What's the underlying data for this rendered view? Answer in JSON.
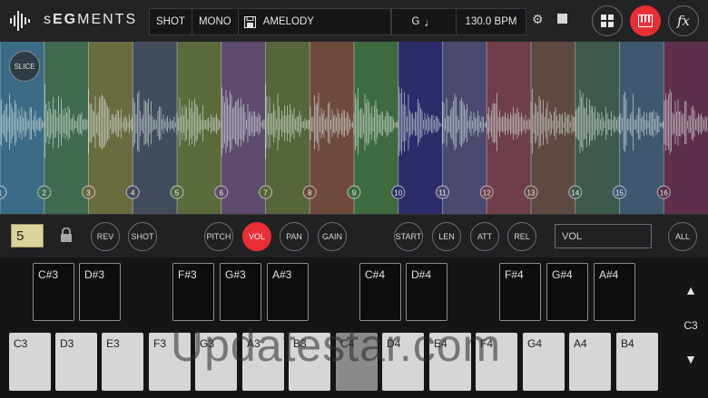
{
  "app": {
    "brand_prefix": "s",
    "brand_bold": "EG",
    "brand_suffix": "MENTS"
  },
  "preset_bar": {
    "mode1": "SHOT",
    "mode2": "MONO",
    "preset_name": "AMELODY",
    "key": "G",
    "tempo": "130.0 BPM"
  },
  "toolbar": {
    "icons": [
      "settings-icon",
      "stop-icon",
      "grid-icon",
      "keyboard-icon",
      "fx-icon"
    ],
    "fx_label": "fx"
  },
  "waveform": {
    "slice_button": "SLICE",
    "slice_colors": [
      "#3b6b87",
      "#3f6a4f",
      "#6b6b40",
      "#414d5c",
      "#5a6a3a",
      "#5e4b6e",
      "#56663a",
      "#6e4a3e",
      "#3e6a42",
      "#2d2c6a",
      "#4a4a6e",
      "#6e3e4a",
      "#5e4a40",
      "#3e5a4c",
      "#3e5870",
      "#5e2f4a"
    ],
    "markers": [
      "1",
      "2",
      "3",
      "4",
      "5",
      "6",
      "7",
      "8",
      "9",
      "10",
      "11",
      "12",
      "13",
      "14",
      "15",
      "16"
    ]
  },
  "controls": {
    "slice_number": "5",
    "buttons": [
      "REV",
      "SHOT",
      "PITCH",
      "VOL",
      "PAN",
      "GAIN",
      "START",
      "LEN",
      "ATT",
      "REL",
      "ALL"
    ],
    "active": "VOL",
    "param_display": "VOL"
  },
  "keyboard": {
    "white_keys": [
      "C3",
      "D3",
      "E3",
      "F3",
      "G3",
      "A3",
      "B3",
      "C4",
      "D4",
      "E4",
      "F4",
      "G4",
      "A4",
      "B4"
    ],
    "black_keys": [
      "C#3",
      "D#3",
      "F#3",
      "G#3",
      "A#3",
      "C#4",
      "D#4",
      "F#4",
      "G#4",
      "A#4"
    ],
    "active_key": "C4",
    "octave_label": "C3"
  },
  "watermark": "Updatestar.com"
}
